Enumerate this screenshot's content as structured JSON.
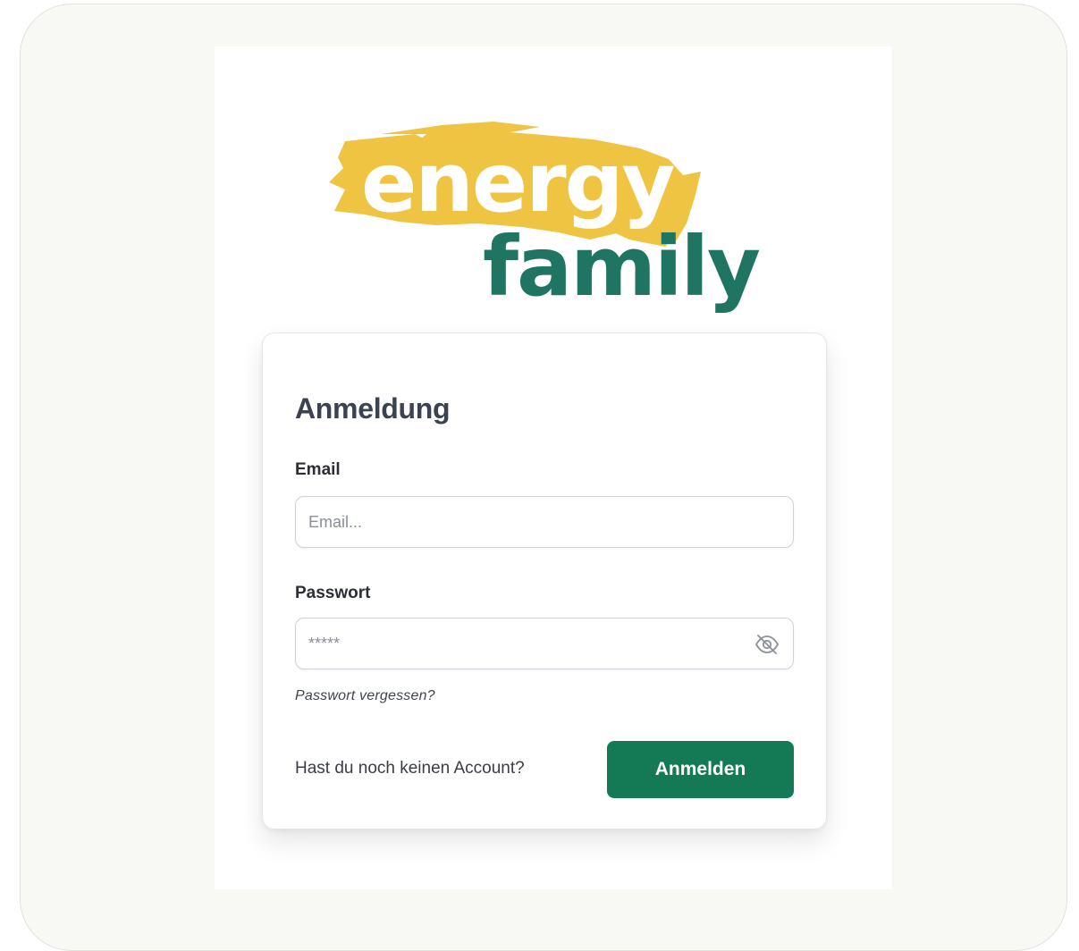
{
  "logo": {
    "word_top": "energy",
    "word_bottom": "family",
    "brush_color": "#f0c443",
    "word_top_color": "#ffffff",
    "word_bottom_color": "#1f7561"
  },
  "login": {
    "title": "Anmeldung",
    "email_label": "Email",
    "email_placeholder": "Email...",
    "email_value": "",
    "password_label": "Passwort",
    "password_placeholder": "*****",
    "password_value": "",
    "password_toggle_icon": "eye-off-icon",
    "forgot_link": "Passwort vergessen?",
    "signup_prompt": "Hast du noch keinen Account?",
    "submit_label": "Anmelden"
  },
  "colors": {
    "primary": "#137a55",
    "background": "#f8f8f4",
    "title_text": "#3b4252"
  }
}
